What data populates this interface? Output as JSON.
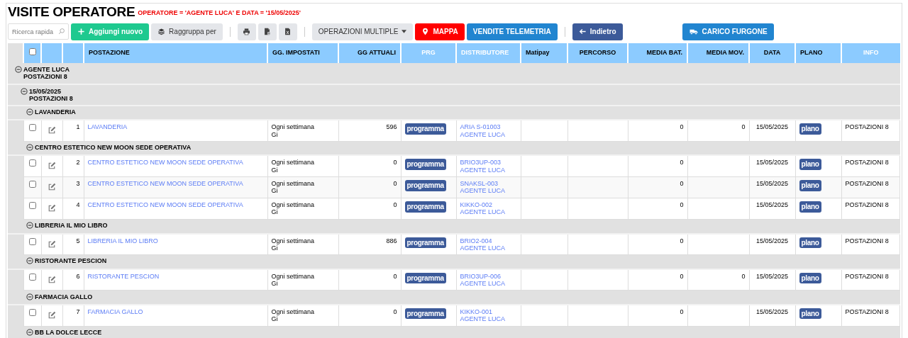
{
  "title": "VISITE OPERATORE",
  "filter": "OPERATORE = 'AGENTE LUCA' E DATA = '15/05/2025'",
  "toolbar": [
    {
      "kind": "search",
      "placeholder": "Ricerca rapida"
    },
    {
      "kind": "add",
      "label": "Aggiungi nuovo"
    },
    {
      "kind": "group",
      "label": "Raggruppa per"
    },
    {
      "kind": "separator"
    },
    {
      "kind": "print"
    },
    {
      "kind": "pdf"
    },
    {
      "kind": "excel"
    },
    {
      "kind": "separator"
    },
    {
      "kind": "dropdown",
      "label": "OPERAZIONI MULTIPLE"
    },
    {
      "kind": "map",
      "label": "MAPPA"
    },
    {
      "kind": "telemetry",
      "label": "VENDITE TELEMETRIA"
    },
    {
      "kind": "separator"
    },
    {
      "kind": "back",
      "label": "Indietro"
    },
    {
      "kind": "spacer"
    },
    {
      "kind": "truck",
      "label": "CARICO FURGONE"
    }
  ],
  "table": {
    "select_all": {
      "checked": false
    },
    "columns": [
      {
        "label": "POSTAZIONE",
        "white_text": false
      },
      {
        "label": "GG. IMPOSTATI",
        "white_text": false
      },
      {
        "label": "GG ATTUALI",
        "white_text": false
      },
      {
        "label": "PRG",
        "white_text": true
      },
      {
        "label": "DISTRIBUTORE",
        "white_text": true
      },
      {
        "label": "Matipay",
        "white_text": false
      },
      {
        "label": "PERCORSO",
        "white_text": false
      },
      {
        "label": "MEDIA BAT.",
        "white_text": false
      },
      {
        "label": "MEDIA MOV.",
        "white_text": false
      },
      {
        "label": "DATA",
        "white_text": false
      },
      {
        "label": "PLANO",
        "white_text": false
      },
      {
        "label": "INFO",
        "white_text": true
      }
    ],
    "groups": [
      {
        "label": "AGENTE LUCA",
        "count": "POSTAZIONI 8",
        "expanded": true,
        "children": [
          {
            "label": "15/05/2025",
            "count": "POSTAZIONI 8",
            "expanded": true,
            "children": [
              {
                "label": "LAVANDERIA",
                "expanded": true,
                "rows": [
                  {
                    "checked": false,
                    "num": "1",
                    "postazione": "LAVANDERIA",
                    "gg_impostati": [
                      "Ogni settimana",
                      "Gi"
                    ],
                    "gg_attuali": "596",
                    "prg": "programma",
                    "distributore": [
                      "ARIA S-01003",
                      "AGENTE LUCA"
                    ],
                    "media_bat": "0",
                    "media_mov": "0",
                    "data": "15/05/2025",
                    "plano": "plano",
                    "info": "POSTAZIONI 8"
                  }
                ]
              },
              {
                "label": "CENTRO ESTETICO NEW MOON SEDE OPERATIVA",
                "expanded": true,
                "rows": [
                  {
                    "checked": false,
                    "num": "2",
                    "postazione": "CENTRO ESTETICO NEW MOON SEDE OPERATIVA",
                    "gg_impostati": [
                      "Ogni settimana",
                      "Gi"
                    ],
                    "gg_attuali": "0",
                    "prg": "programma",
                    "distributore": [
                      "BRIO3UP-003",
                      "AGENTE LUCA"
                    ],
                    "media_bat": "0",
                    "data": "15/05/2025",
                    "plano": "plano",
                    "info": "POSTAZIONI 8"
                  },
                  {
                    "checked": false,
                    "num": "3",
                    "postazione": "CENTRO ESTETICO NEW MOON SEDE OPERATIVA",
                    "gg_impostati": [
                      "Ogni settimana",
                      "Gi"
                    ],
                    "gg_attuali": "0",
                    "prg": "programma",
                    "distributore": [
                      "SNAKSL-003",
                      "AGENTE LUCA"
                    ],
                    "media_bat": "0",
                    "data": "15/05/2025",
                    "plano": "plano",
                    "info": "POSTAZIONI 8"
                  },
                  {
                    "checked": false,
                    "num": "4",
                    "postazione": "CENTRO ESTETICO NEW MOON SEDE OPERATIVA",
                    "gg_impostati": [
                      "Ogni settimana",
                      "Gi"
                    ],
                    "gg_attuali": "0",
                    "prg": "programma",
                    "distributore": [
                      "KIKKO-002",
                      "AGENTE LUCA"
                    ],
                    "media_bat": "0",
                    "data": "15/05/2025",
                    "plano": "plano",
                    "info": "POSTAZIONI 8"
                  }
                ]
              },
              {
                "label": "LIBRERIA IL MIO LIBRO",
                "expanded": true,
                "rows": [
                  {
                    "checked": false,
                    "num": "5",
                    "postazione": "LIBRERIA IL MIO LIBRO",
                    "gg_impostati": [
                      "Ogni settimana",
                      "Gi"
                    ],
                    "gg_attuali": "886",
                    "prg": "programma",
                    "distributore": [
                      "BRIO2-004",
                      "AGENTE LUCA"
                    ],
                    "media_bat": "0",
                    "data": "15/05/2025",
                    "plano": "plano",
                    "info": "POSTAZIONI 8"
                  }
                ]
              },
              {
                "label": "RISTORANTE PESCION",
                "expanded": true,
                "rows": [
                  {
                    "checked": false,
                    "num": "6",
                    "postazione": "RISTORANTE PESCION",
                    "gg_impostati": [
                      "Ogni settimana",
                      "Gi"
                    ],
                    "gg_attuali": "0",
                    "prg": "programma",
                    "distributore": [
                      "BRIO3UP-006",
                      "AGENTE LUCA"
                    ],
                    "media_bat": "0",
                    "media_mov": "0",
                    "data": "15/05/2025",
                    "plano": "plano",
                    "info": "POSTAZIONI 8"
                  }
                ]
              },
              {
                "label": "FARMACIA GALLO",
                "expanded": true,
                "rows": [
                  {
                    "checked": false,
                    "num": "7",
                    "postazione": "FARMACIA GALLO",
                    "gg_impostati": [
                      "Ogni settimana",
                      "Gi"
                    ],
                    "gg_attuali": "0",
                    "prg": "programma",
                    "distributore": [
                      "KIKKO-001",
                      "AGENTE LUCA"
                    ],
                    "media_bat": "0",
                    "data": "15/05/2025",
                    "plano": "plano",
                    "info": "POSTAZIONI 8"
                  }
                ]
              },
              {
                "label": "BB LA DOLCE LECCE",
                "expanded": true
              }
            ]
          }
        ]
      }
    ]
  }
}
